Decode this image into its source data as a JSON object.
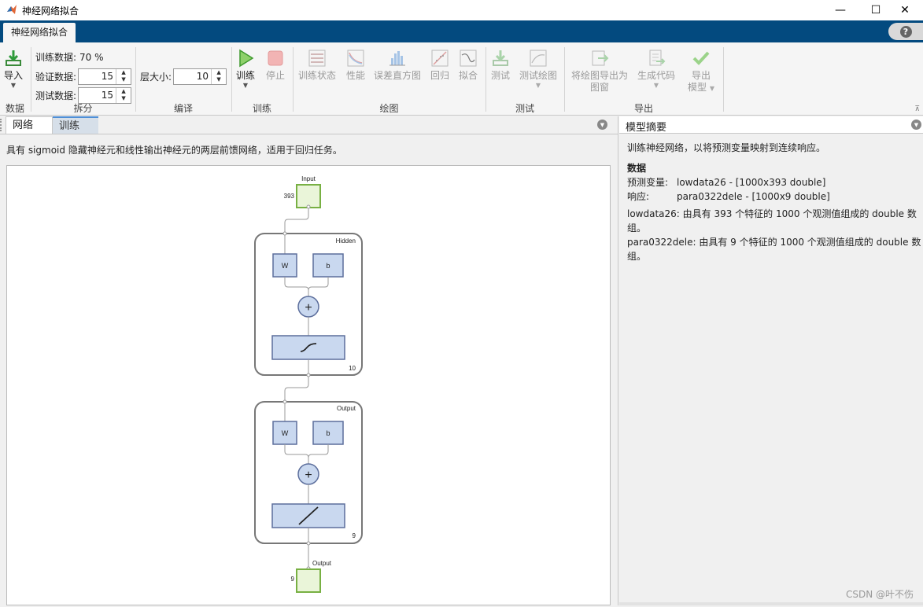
{
  "window": {
    "title": "神经网络拟合",
    "controls": [
      "—",
      "☐",
      "✕"
    ]
  },
  "ribbon": {
    "tab": "神经网络拟合",
    "help": "?"
  },
  "toolstrip": {
    "data": {
      "import_label": "导入",
      "section": "数据"
    },
    "split": {
      "train_label": "训练数据:",
      "train_value": "70 %",
      "validation_label": "验证数据:",
      "validation_value": "15",
      "test_label": "测试数据:",
      "test_value": "15",
      "section": "拆分"
    },
    "build": {
      "layer_size_label": "层大小:",
      "layer_size_value": "10",
      "section": "编译"
    },
    "train": {
      "train_label": "训练",
      "stop_label": "停止",
      "section": "训练"
    },
    "plots": {
      "items": [
        "训练状态",
        "性能",
        "误差直方图",
        "回归",
        "拟合"
      ],
      "section": "绘图"
    },
    "test": {
      "test_label": "测试",
      "test_plot_label": "测试绘图",
      "section": "测试"
    },
    "export": {
      "export_plot_label_1": "将绘图导出为",
      "export_plot_label_2": "图窗",
      "generate_code_label": "生成代码",
      "export_model_label_1": "导出",
      "export_model_label_2": "模型",
      "section": "导出"
    }
  },
  "left_panel": {
    "tabs": [
      "网络",
      "训练"
    ],
    "description": "具有 sigmoid 隐藏神经元和线性输出神经元的两层前馈网络，适用于回归任务。",
    "diagram": {
      "input_label": "Input",
      "input_size": "393",
      "hidden_label": "Hidden",
      "hidden_size": "10",
      "output_layer_label": "Output",
      "output_layer_size": "9",
      "output_label": "Output",
      "output_size": "9",
      "weight": "W",
      "bias": "b",
      "plus": "+"
    }
  },
  "right_panel": {
    "title": "模型摘要",
    "intro": "训练神经网络，以将预测变量映射到连续响应。",
    "data_heading": "数据",
    "predictors_key": "预测变量:",
    "predictors_value": "lowdata26 - [1000x393 double]",
    "response_key": "响应:",
    "response_value": "para0322dele - [1000x9 double]",
    "note_1": "lowdata26: 由具有 393 个特征的 1000 个观测值组成的 double 数组。",
    "note_2": "para0322dele: 由具有 9 个特征的 1000 个观测值组成的 double 数组。",
    "watermark": "CSDN @叶不伤"
  },
  "colors": {
    "ribbon_blue": "#034a7f",
    "node_green": "#78b043",
    "block_blue": "#c9d8ef",
    "block_border": "#5c6e9c"
  }
}
